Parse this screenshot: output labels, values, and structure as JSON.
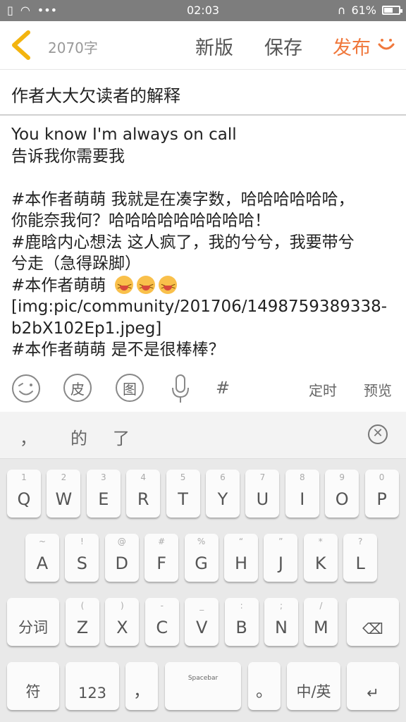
{
  "status_bar": {
    "time": "02:03",
    "battery": "61%",
    "battery_level": 0.61
  },
  "toolbar": {
    "word_count": "2070字",
    "new_version": "新版",
    "save": "保存",
    "publish": "发布"
  },
  "title": "作者大大欠读者的解释",
  "body_lines": [
    "You know I'm always on call",
    "告诉我你需要我",
    "",
    "#本作者萌萌 我就是在凑字数，哈哈哈哈哈哈，",
    "你能奈我何？哈哈哈哈哈哈哈哈哈！",
    "#鹿晗内心想法 这人疯了，我的兮兮，我要带兮",
    "兮走（急得跺脚）",
    "#本作者萌萌 ",
    "[img:pic/community/201706/1498759389338-",
    "b2bX102Ep1.jpeg]",
    "#本作者萌萌 是不是很棒棒？"
  ],
  "format_bar": {
    "skin": "皮",
    "image": "图",
    "hashtag": "#",
    "schedule": "定时",
    "preview": "预览"
  },
  "candidates": [
    "，",
    "的",
    "了"
  ],
  "keyboard": {
    "row1": [
      {
        "sub": "1",
        "main": "Q"
      },
      {
        "sub": "2",
        "main": "W"
      },
      {
        "sub": "3",
        "main": "E"
      },
      {
        "sub": "4",
        "main": "R"
      },
      {
        "sub": "5",
        "main": "T"
      },
      {
        "sub": "6",
        "main": "Y"
      },
      {
        "sub": "7",
        "main": "U"
      },
      {
        "sub": "8",
        "main": "I"
      },
      {
        "sub": "9",
        "main": "O"
      },
      {
        "sub": "0",
        "main": "P"
      }
    ],
    "row2": [
      {
        "sub": "~",
        "main": "A"
      },
      {
        "sub": "!",
        "main": "S"
      },
      {
        "sub": "@",
        "main": "D"
      },
      {
        "sub": "#",
        "main": "F"
      },
      {
        "sub": "%",
        "main": "G"
      },
      {
        "sub": "“",
        "main": "H"
      },
      {
        "sub": "”",
        "main": "J"
      },
      {
        "sub": "*",
        "main": "K"
      },
      {
        "sub": "?",
        "main": "L"
      }
    ],
    "row3": [
      {
        "sub": "(",
        "main": "Z"
      },
      {
        "sub": ")",
        "main": "X"
      },
      {
        "sub": "-",
        "main": "C"
      },
      {
        "sub": "_",
        "main": "V"
      },
      {
        "sub": ":",
        "main": "B"
      },
      {
        "sub": ";",
        "main": "N"
      },
      {
        "sub": "/",
        "main": "M"
      }
    ],
    "fenci": "分词",
    "backspace": "⌫",
    "symbols": "符",
    "numbers": "123",
    "comma": "，",
    "spacebar": "Spacebar",
    "period": "。",
    "lang": "中/英",
    "enter": "↵"
  }
}
